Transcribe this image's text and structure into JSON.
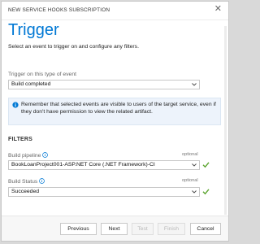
{
  "window": {
    "title": "NEW SERVICE HOOKS SUBSCRIPTION",
    "close_icon": "close-icon"
  },
  "header": {
    "title": "Trigger",
    "subtitle": "Select an event to trigger on and configure any filters."
  },
  "trigger": {
    "label": "Trigger on this type of event",
    "value": "Build completed"
  },
  "info": {
    "icon": "info-icon",
    "text": "Remember that selected events are visible to users of the target service, even if they don't have permission to view the related artifact."
  },
  "filters": {
    "heading": "FILTERS",
    "build_pipeline": {
      "label": "Build pipeline",
      "optional": "optional",
      "value": "BookLoanProject001-ASP.NET Core (.NET Framework)-CI"
    },
    "build_status": {
      "label": "Build Status",
      "optional": "optional",
      "value": "Succeeded"
    }
  },
  "footer": {
    "previous": "Previous",
    "next": "Next",
    "test": "Test",
    "finish": "Finish",
    "cancel": "Cancel"
  },
  "colors": {
    "accent": "#0078d4",
    "check": "#5ba42e",
    "info_bg": "#edf3fb"
  }
}
